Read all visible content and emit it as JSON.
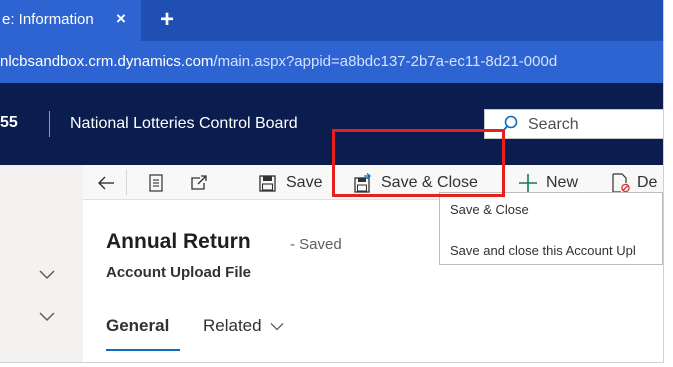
{
  "browser": {
    "tab_title": "e: Information",
    "close_glyph": "×",
    "new_tab_glyph": "+",
    "url_host": "nlcbsandbox.crm.dynamics.com",
    "url_path": "/main.aspx?appid=a8bdc137-2b7a-ec11-8d21-000d"
  },
  "appbar": {
    "brand": "55",
    "org_name": "National Lotteries Control Board",
    "search_placeholder": "Search"
  },
  "commands": {
    "save": "Save",
    "save_close": "Save & Close",
    "new": "New",
    "delete": "De"
  },
  "record": {
    "title": "Annual Return",
    "status": "- Saved",
    "entity": "Account Upload File"
  },
  "tabs": [
    {
      "label": "General",
      "active": true
    },
    {
      "label": "Related",
      "active": false
    }
  ],
  "tooltip": {
    "title": "Save & Close",
    "description": "Save and close this Account Upl"
  },
  "colors": {
    "highlight": "#e8201d",
    "app_header": "#0a1d4e",
    "browser_chrome": "#2e64d1",
    "accent": "#0f6cbd"
  },
  "icons": [
    "close-icon",
    "plus-icon",
    "search-icon",
    "back-arrow-icon",
    "form-icon",
    "open-new-window-icon",
    "save-icon",
    "save-close-icon",
    "delete-icon",
    "chevron-down-icon"
  ]
}
